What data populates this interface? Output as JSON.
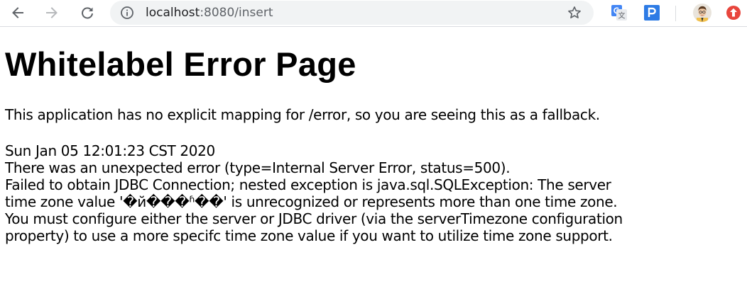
{
  "browser": {
    "url_host": "localhost",
    "url_rest": ":8080/insert",
    "icons": {
      "back": "back-arrow-icon",
      "forward": "forward-arrow-icon",
      "reload": "reload-icon",
      "site_info": "info-icon",
      "bookmark": "star-icon",
      "translate_extension": "google-translate-icon",
      "parking_extension": "p-icon",
      "update": "red-up-arrow-icon"
    },
    "colors": {
      "omnibox_bg": "#f1f3f4",
      "icon": "#5f6368",
      "translate_blue": "#4285f4",
      "parking_blue": "#2d7be5",
      "update_red": "#e8453c"
    }
  },
  "page": {
    "title": "Whitelabel Error Page",
    "fallback_message": "This application has no explicit mapping for /error, so you are seeing this as a fallback.",
    "timestamp": "Sun Jan 05 12:01:23 CST 2020",
    "error_lines": [
      "There was an unexpected error (type=Internal Server Error, status=500).",
      "Failed to obtain JDBC Connection; nested exception is java.sql.SQLException: The server",
      "time zone value '�й���ʱ��' is unrecognized or represents more than one time zone.",
      "You must configure either the server or JDBC driver (via the serverTimezone configuration",
      "property) to use a more specifc time zone value if you want to utilize time zone support."
    ]
  }
}
